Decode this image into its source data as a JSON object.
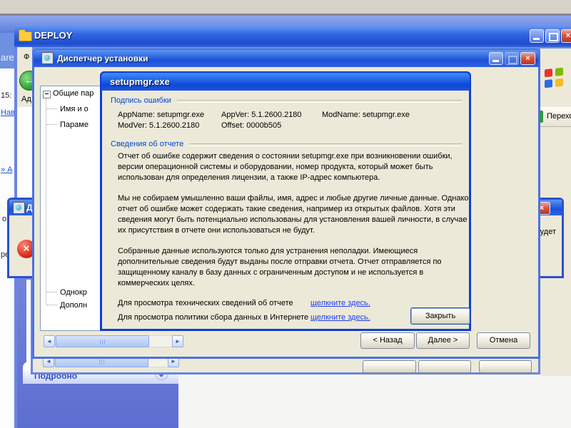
{
  "glyphs": {
    "close": "×",
    "back_arrow": "←",
    "scroll_left": "◄",
    "scroll_right": "►",
    "error_x": "×"
  },
  "background": {
    "header_fragment": "are",
    "page_fragments": {
      "time": "15:",
      "nav_link": "Нав",
      "arrow_link": "» А",
      "frag_o": "о",
      "frag_re": "ре"
    },
    "go_button_label": "Переход"
  },
  "deploy_window": {
    "title": "DEPLOY",
    "menu_file_fragment": "Ф",
    "address_label_fragment": "Ад"
  },
  "details_panel": {
    "header": "Подробно"
  },
  "wizard": {
    "title": "Диспетчер установки",
    "tree_items": [
      "Общие пар",
      "Имя и о",
      "Параме",
      "Однокр",
      "Дополн"
    ],
    "back_label": "< Назад",
    "next_label": "Далее >",
    "cancel_label": "Отмена"
  },
  "error_box": {
    "title_fragment": "Д",
    "message_fragment": "удет"
  },
  "report_dialog": {
    "title": "setupmgr.exe",
    "signature_group": "Подпись ошибки",
    "signature": {
      "app_name": "AppName: setupmgr.exe",
      "app_ver": "AppVer: 5.1.2600.2180",
      "mod_name": "ModName: setupmgr.exe",
      "mod_ver": "ModVer: 5.1.2600.2180",
      "offset": "Offset: 0000b505"
    },
    "details_group": "Сведения об отчете",
    "paragraphs": {
      "p1": "Отчет об ошибке содержит сведения о состоянии setupmgr.exe при возникновении ошибки, версии операционной системы и оборудовании, номер продукта, который может быть использован для определения лицензии, а также IP-адрес компьютера.",
      "p2": "Мы не собираем умышленно ваши файлы, имя, адрес и любые другие личные данные. Однако отчет об ошибке может содержать такие сведения, например из открытых файлов. Хотя эти сведения могут быть потенциально использованы для установления вашей личности, в случае их присутствия в отчете они использоваться не будут.",
      "p3": "Собранные данные используются только для устранения неполадки. Имеющиеся дополнительные сведения будут выданы после отправки отчета. Отчет отправляется по защищенному каналу в базу данных с ограниченным доступом и не используется в коммерческих целях."
    },
    "links": {
      "row1_label": "Для просмотра технических сведений об отчете",
      "row1_link": "щелкните здесь.",
      "row2_label": "Для просмотра политики сбора данных в Интернете",
      "row2_link": "щелкните здесь."
    },
    "close_label": "Закрыть"
  },
  "colors": {
    "titlebar_blue": "#1C50D8",
    "client_beige": "#ECE9D8",
    "taskpane_blue": "#6374D4",
    "link_blue": "#1E3FEF",
    "group_label_blue": "#0046D5"
  }
}
